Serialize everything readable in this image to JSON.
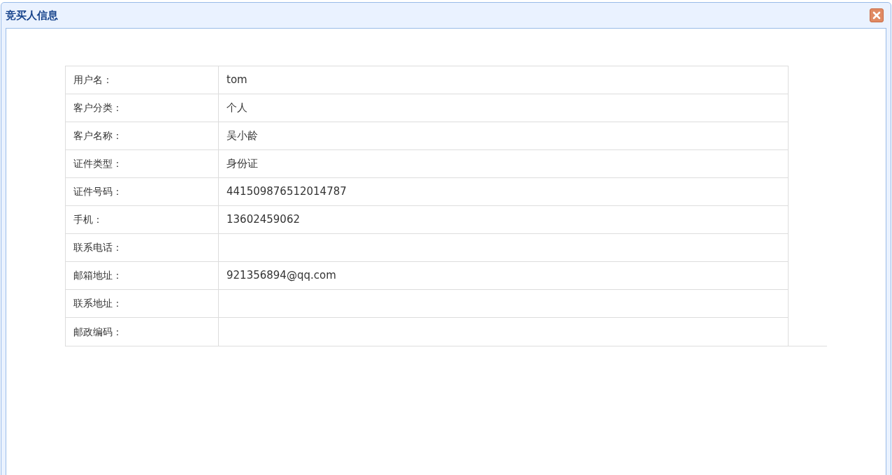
{
  "window": {
    "title": "竞买人信息"
  },
  "rows": [
    {
      "label": "用户名：",
      "value": "tom"
    },
    {
      "label": "客户分类：",
      "value": "个人"
    },
    {
      "label": "客户名称：",
      "value": "吴小龄"
    },
    {
      "label": "证件类型：",
      "value": "身份证"
    },
    {
      "label": "证件号码：",
      "value": "441509876512014787"
    },
    {
      "label": "手机：",
      "value": "13602459062"
    },
    {
      "label": "联系电话："
    },
    {
      "label": "邮箱地址：",
      "value": "921356894@qq.com"
    },
    {
      "label": "联系地址："
    },
    {
      "label": "邮政编码："
    }
  ]
}
